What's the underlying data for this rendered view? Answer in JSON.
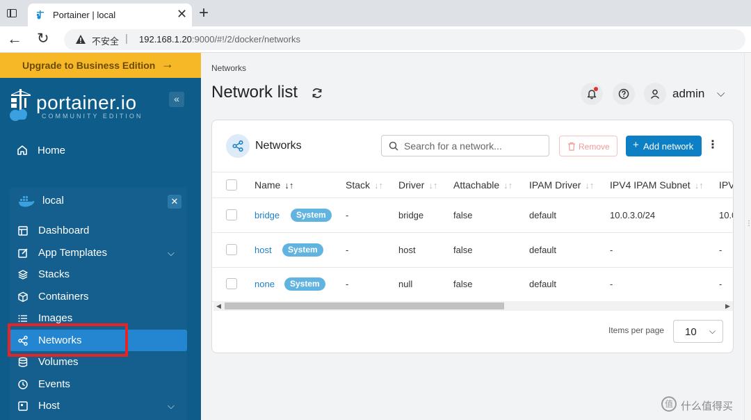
{
  "browser": {
    "tab_title": "Portainer | local",
    "security_label": "不安全",
    "url_host": "192.168.1.20",
    "url_rest": ":9000/#!/2/docker/networks"
  },
  "sidebar": {
    "upgrade_label": "Upgrade to Business Edition",
    "logo_text": "portainer.io",
    "logo_sub": "COMMUNITY EDITION",
    "home_label": "Home",
    "environment": "local",
    "menu": [
      {
        "label": "Dashboard",
        "icon": "dashboard-icon"
      },
      {
        "label": "App Templates",
        "icon": "edit-icon"
      },
      {
        "label": "Stacks",
        "icon": "layers-icon"
      },
      {
        "label": "Containers",
        "icon": "box-icon"
      },
      {
        "label": "Images",
        "icon": "list-icon"
      },
      {
        "label": "Networks",
        "icon": "share-icon"
      },
      {
        "label": "Volumes",
        "icon": "database-icon"
      },
      {
        "label": "Events",
        "icon": "clock-icon"
      },
      {
        "label": "Host",
        "icon": "server-icon"
      }
    ]
  },
  "header": {
    "breadcrumb": "Networks",
    "title": "Network list",
    "user": "admin"
  },
  "card": {
    "title": "Networks",
    "search_placeholder": "Search for a network...",
    "remove_label": "Remove",
    "add_label": "Add network",
    "columns": [
      "Name",
      "Stack",
      "Driver",
      "Attachable",
      "IPAM Driver",
      "IPV4 IPAM Subnet",
      "IPV"
    ],
    "rows": [
      {
        "name": "bridge",
        "badge": "System",
        "stack": "-",
        "driver": "bridge",
        "attachable": "false",
        "ipam_driver": "default",
        "subnet": "10.0.3.0/24",
        "more": "10.0"
      },
      {
        "name": "host",
        "badge": "System",
        "stack": "-",
        "driver": "host",
        "attachable": "false",
        "ipam_driver": "default",
        "subnet": "-",
        "more": "-"
      },
      {
        "name": "none",
        "badge": "System",
        "stack": "-",
        "driver": "null",
        "attachable": "false",
        "ipam_driver": "default",
        "subnet": "-",
        "more": "-"
      }
    ],
    "items_per_page_label": "Items per page",
    "items_per_page": "10"
  },
  "watermark": "什么值得买",
  "colors": {
    "sidebar_bg": "#0e5c8a",
    "upgrade_bg": "#f7b827",
    "accent": "#0d80c5",
    "active_item": "#2486d0",
    "highlight_box": "#e52525",
    "badge": "#61b4e0"
  }
}
